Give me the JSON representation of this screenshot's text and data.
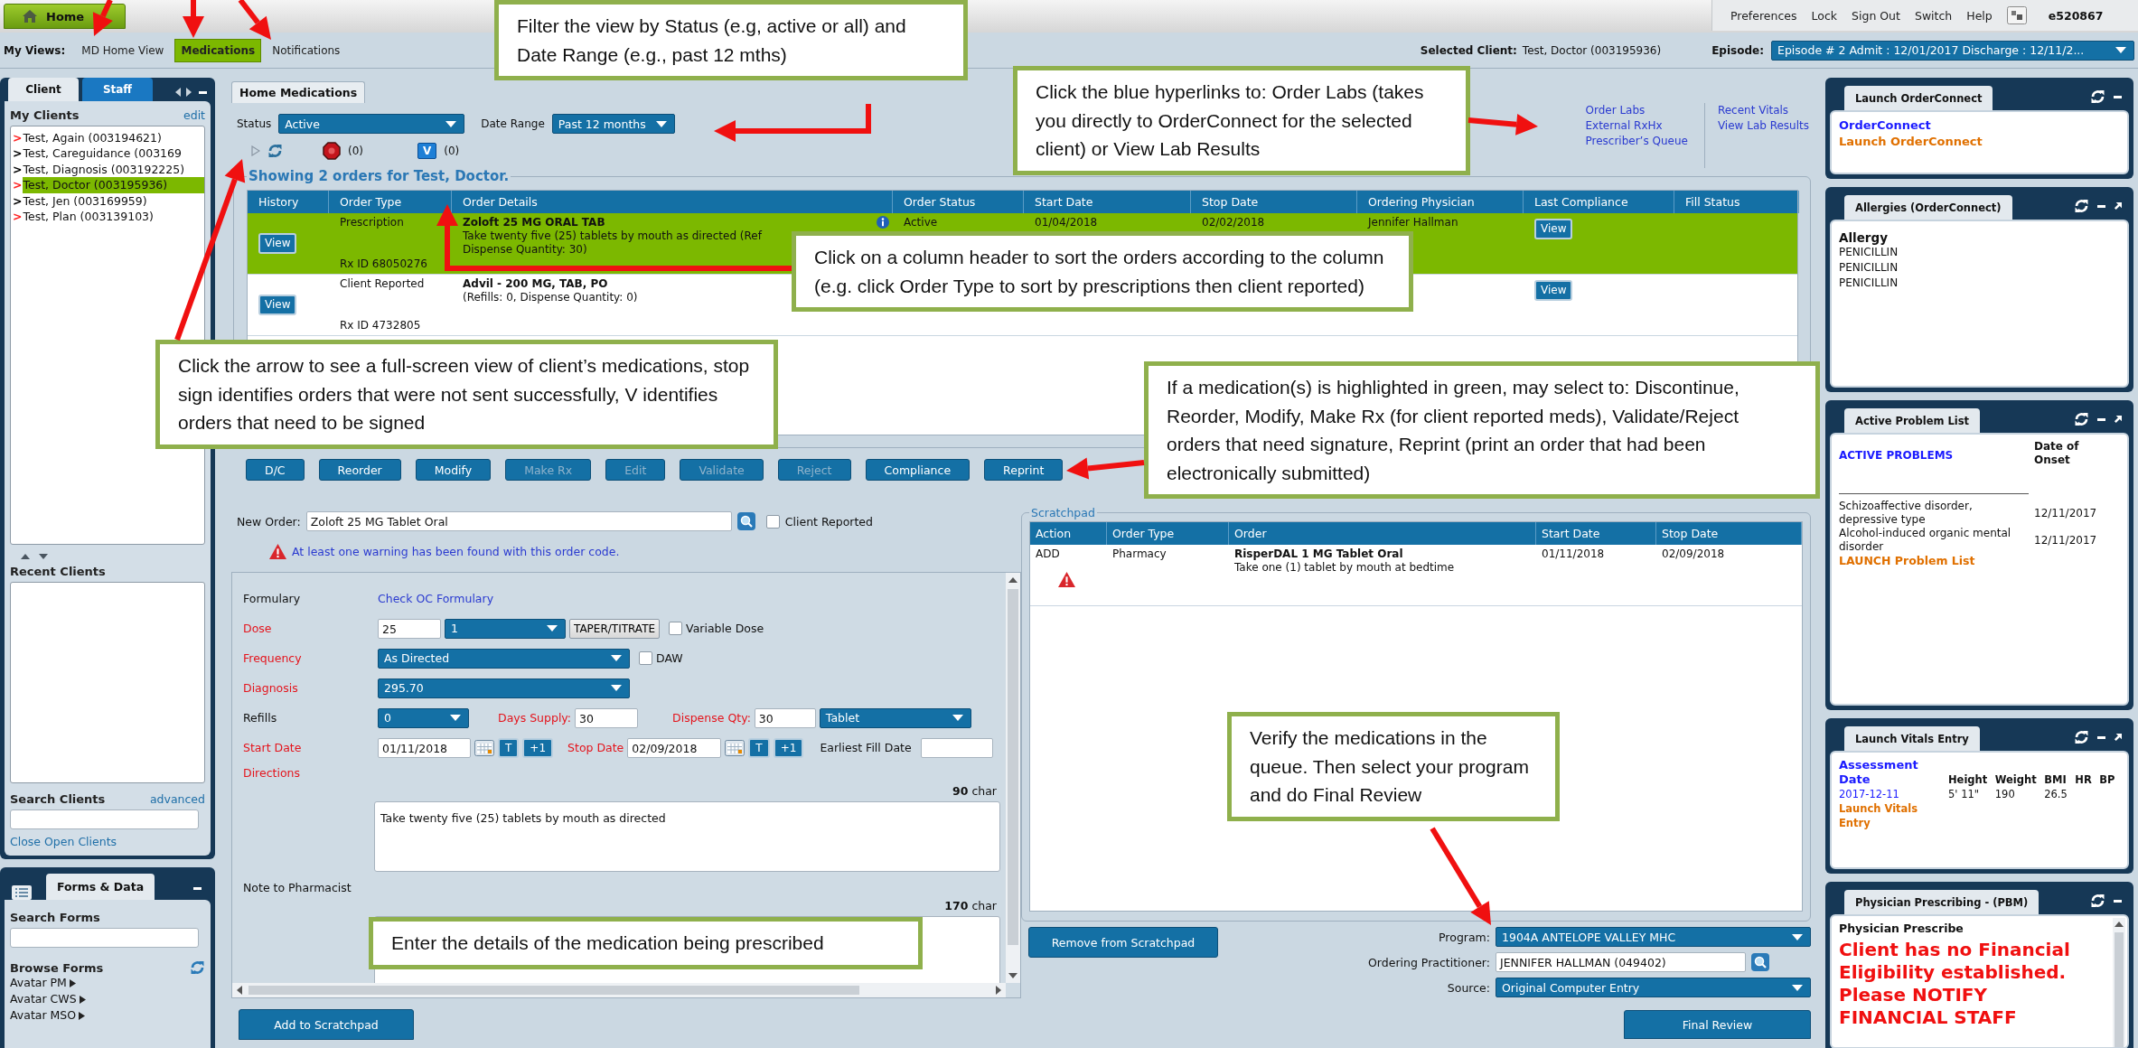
{
  "top_bar": {
    "home": "Home",
    "links": [
      "Preferences",
      "Lock",
      "Sign Out",
      "Switch",
      "Help"
    ],
    "user": "e520867"
  },
  "views": {
    "label": "My Views:",
    "items": [
      {
        "label": "MD Home View",
        "selected": false
      },
      {
        "label": "Medications",
        "selected": true
      },
      {
        "label": "Notifications",
        "selected": false
      }
    ],
    "selected_client_label": "Selected Client:",
    "selected_client": "Test, Doctor (003195936)",
    "episode_label": "Episode:",
    "episode": "Episode # 2 Admit : 12/01/2017 Discharge : 12/11/2..."
  },
  "client_panel": {
    "tabs": [
      {
        "label": "Client",
        "selected": true
      },
      {
        "label": "Staff",
        "selected": false
      }
    ],
    "my_clients_title": "My Clients",
    "edit": "edit",
    "clients": [
      {
        "marker": ">",
        "name": "Test, Again (003194621)",
        "color": "#ff2020",
        "selected": false
      },
      {
        "marker": ">",
        "name": "Test, Careguidance (003169",
        "color": "#000000",
        "selected": false
      },
      {
        "marker": ">",
        "name": "Test, Diagnosis (003192225)",
        "color": "#000000",
        "selected": false
      },
      {
        "marker": ">",
        "name": "Test, Doctor (003195936)",
        "color": "#ff2020",
        "selected": true
      },
      {
        "marker": ">",
        "name": "Test, Jen (003169959)",
        "color": "#000000",
        "selected": false
      },
      {
        "marker": ">",
        "name": "Test, Plan (003139103)",
        "color": "#ff2020",
        "selected": false
      }
    ],
    "recent_title": "Recent Clients",
    "search_title": "Search Clients",
    "advanced": "advanced",
    "close_open": "Close Open Clients"
  },
  "forms_panel": {
    "title": "Forms & Data",
    "search_title": "Search Forms",
    "browse_title": "Browse Forms",
    "items": [
      "Avatar PM",
      "Avatar CWS",
      "Avatar MSO"
    ]
  },
  "medications": {
    "tab": "Home Medications",
    "status_label": "Status",
    "status": "Active",
    "date_label": "Date Range",
    "date_range": "Past 12 months",
    "stop_count": "(0)",
    "validate_letter": "V",
    "validate_count": "(0)",
    "links_col1": [
      "Order Labs",
      "External RxHx",
      "Prescriber’s Queue"
    ],
    "links_col2": [
      "Recent Vitals",
      "View Lab Results"
    ],
    "legend": "Showing 2 orders for Test, Doctor.",
    "columns": [
      "History",
      "Order Type",
      "Order Details",
      "Order Status",
      "Start Date",
      "Stop Date",
      "Ordering Physician",
      "Last Compliance",
      "Fill Status"
    ],
    "rows": [
      {
        "selected": true,
        "history": "View",
        "order_type": "Prescription",
        "rx_id": "Rx ID 68050276",
        "drug": "Zoloft 25 MG ORAL TAB",
        "details": [
          "Take twenty five (25) tablets by mouth as directed (Ref",
          "Dispense Quantity: 30)"
        ],
        "info": true,
        "status": "Active",
        "start": "01/04/2018",
        "stop": "02/02/2018",
        "physician": "Jennifer Hallman",
        "compliance": "View"
      },
      {
        "selected": false,
        "history": "View",
        "order_type": "Client Reported",
        "rx_id": "Rx ID 4732805",
        "drug": "Advil - 200 MG, TAB, PO",
        "details": [
          "(Refills: 0, Dispense Quantity: 0)"
        ],
        "info": false,
        "compliance": "View"
      }
    ]
  },
  "actions": [
    {
      "label": "D/C",
      "disabled": false
    },
    {
      "label": "Reorder",
      "disabled": false
    },
    {
      "label": "Modify",
      "disabled": false
    },
    {
      "label": "Make Rx",
      "disabled": true
    },
    {
      "label": "Edit",
      "disabled": true
    },
    {
      "label": "Validate",
      "disabled": true
    },
    {
      "label": "Reject",
      "disabled": true
    },
    {
      "label": "Compliance",
      "disabled": false
    },
    {
      "label": "Reprint",
      "disabled": false
    }
  ],
  "order_form": {
    "new_order": {
      "label": "New Order:",
      "value": "Zoloft 25 MG Tablet Oral"
    },
    "client_reported": {
      "label": "Client Reported",
      "checked": false
    },
    "warning": "At least one warning has been found with this order code.",
    "formulary": {
      "label": "Formulary",
      "required": false,
      "link": "Check OC Formulary"
    },
    "dose": {
      "label": "Dose",
      "required": true,
      "value": "25",
      "unit": "1",
      "taper": "TAPER/TITRATE",
      "variable": {
        "label": "Variable Dose",
        "checked": false
      }
    },
    "frequency": {
      "label": "Frequency",
      "required": true,
      "value": "As Directed",
      "daw": {
        "label": "DAW",
        "checked": false
      }
    },
    "diagnosis": {
      "label": "Diagnosis",
      "required": true,
      "value": "295.70"
    },
    "refills": {
      "label": "Refills",
      "required": false,
      "value": "0"
    },
    "days_supply": {
      "label": "Days Supply:",
      "required": true,
      "value": "30"
    },
    "dispense_qty": {
      "label": "Dispense Qty:",
      "required": true,
      "value": "30",
      "form": "Tablet"
    },
    "start_date": {
      "label": "Start Date",
      "required": true,
      "value": "01/11/2018",
      "today": "T",
      "plus": "+1"
    },
    "stop_date": {
      "label": "Stop Date",
      "required": true,
      "value": "02/09/2018",
      "today": "T",
      "plus": "+1"
    },
    "earliest_fill": {
      "label": "Earliest Fill Date",
      "required": false
    },
    "directions": {
      "label": "Directions",
      "required": true,
      "count": "**90** char",
      "value": "Take twenty five (25) tablets by mouth as directed"
    },
    "note": {
      "label": "Note to Pharmacist",
      "required": false,
      "count": "**170** char"
    },
    "add": "Add to Scratchpad"
  },
  "scratchpad": {
    "title": "Scratchpad",
    "columns": [
      "Action",
      "Order Type",
      "Order",
      "Start Date",
      "Stop Date"
    ],
    "rows": [
      {
        "action": "ADD",
        "order_type": "Pharmacy",
        "order": "RisperDAL 1 MG Tablet Oral",
        "directions": "Take one (1) tablet by mouth at bedtime",
        "start": "01/11/2018",
        "stop": "02/09/2018",
        "warning": true
      }
    ],
    "remove": "Remove from Scratchpad",
    "program_label": "Program:",
    "program": "1904A ANTELOPE VALLEY MHC",
    "practitioner_label": "Ordering Practitioner:",
    "practitioner": "JENNIFER HALLMAN (049402)",
    "source_label": "Source:",
    "source": "Original Computer Entry",
    "final": "Final Review"
  },
  "right_widgets": [
    {
      "kind": "links",
      "title": "Launch OrderConnect",
      "expandable": false,
      "links": [
        {
          "kind": "title",
          "text": "OrderConnect"
        },
        {
          "kind": "launch",
          "text": "Launch OrderConnect"
        }
      ]
    },
    {
      "kind": "allergies",
      "title": "Allergies (OrderConnect)",
      "expandable": true,
      "heading": "Allergy",
      "items": [
        "PENICILLIN",
        "PENICILLIN",
        "PENICILLIN"
      ]
    },
    {
      "kind": "problems",
      "title": "Active Problem List",
      "expandable": true,
      "heading": "ACTIVE PROBLEMS",
      "date_heading": "Date of Onset",
      "items": [
        {
          "problem": "Schizoaffective disorder, depressive type",
          "date": "12/11/2017"
        },
        {
          "problem": "Alcohol-induced organic mental disorder",
          "date": "12/11/2017"
        }
      ],
      "launch": "LAUNCH Problem List"
    },
    {
      "kind": "vitals",
      "title": "Launch Vitals Entry",
      "expandable": true,
      "columns": [
        "Assessment Date",
        "Height",
        "Weight",
        "BMI",
        "HR",
        "BP"
      ],
      "row": [
        "2017-12-11",
        "5' 11\"",
        "190",
        "26.5"
      ],
      "launch": "Launch Vitals Entry"
    },
    {
      "kind": "prescribing",
      "title": "Physician Prescribing - (PBM)",
      "expandable": false,
      "heading": "Physician Prescribe",
      "alert": "Client has no Financial Eligibility established. Please NOTIFY FINANCIAL STAFF"
    }
  ],
  "callouts": [
    "Filter the view by Status (e.g, active or all) and Date Range (e.g., past 12 mths)",
    "Click the blue hyperlinks to: Order Labs (takes you directly to OrderConnect for the selected client) or View Lab Results",
    "Click on a column header to sort the orders according to the column (e.g. click Order Type to sort by prescriptions then client reported)",
    "Click the arrow to see a full-screen view of client’s medications, stop sign identifies orders that were not sent successfully, V identifies orders that need to be signed",
    "If a medication(s) is highlighted in green, may select to: Discontinue, Reorder, Modify, Make Rx (for client reported meds), Validate/Reject orders that need signature, Reprint (print an order that had been electronically submitted)",
    "Verify the medications in the queue.  Then select your program and do Final Review",
    "Enter the details of the medication being prescribed"
  ]
}
